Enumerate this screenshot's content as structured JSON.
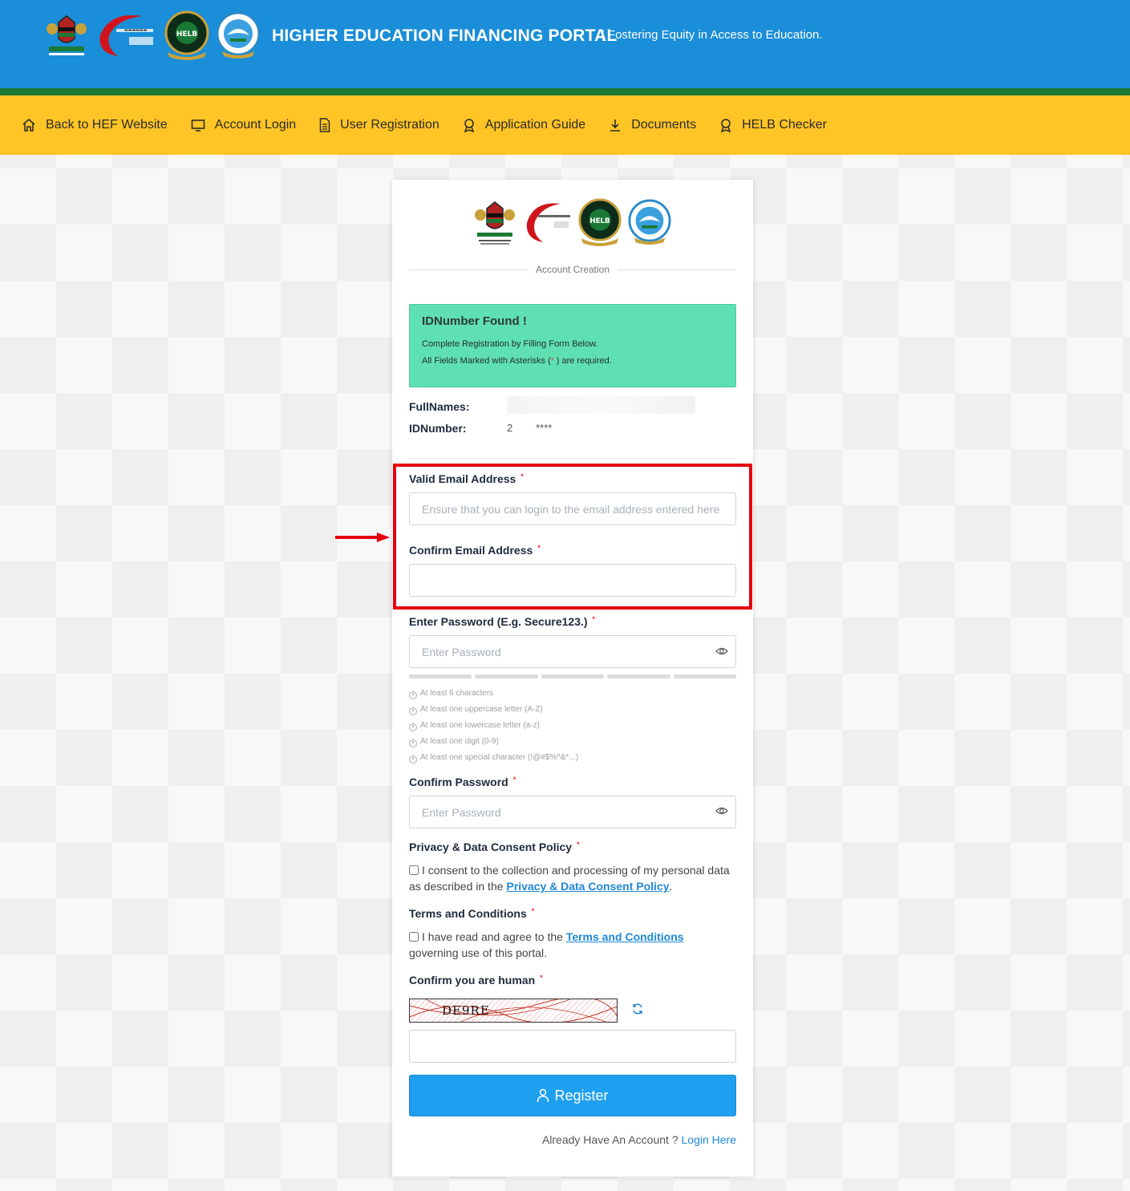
{
  "header": {
    "title": "HIGHER EDUCATION FINANCING PORTAL",
    "tagline": "Fostering Equity in Access to Education."
  },
  "nav": [
    {
      "label": "Back to HEF Website",
      "icon": "home-icon"
    },
    {
      "label": "Account Login",
      "icon": "monitor-icon"
    },
    {
      "label": "User Registration",
      "icon": "document-icon"
    },
    {
      "label": "Application Guide",
      "icon": "award-icon"
    },
    {
      "label": "Documents",
      "icon": "download-icon"
    },
    {
      "label": "HELB Checker",
      "icon": "award-icon"
    }
  ],
  "card": {
    "section_title": "Account Creation",
    "alert": {
      "title": "IDNumber Found !",
      "line1": "Complete Registration by Filling Form Below.",
      "line2_pre": "All Fields Marked with Asterisks (",
      "line2_ast": "*",
      "line2_post": ") are required."
    },
    "fullnames_label": "FullNames:",
    "fullnames_value": "",
    "idnumber_label": "IDNumber:",
    "idnumber_value": "2        ****",
    "email": {
      "label": "Valid Email Address",
      "placeholder": "Ensure that you can login to the email address entered here",
      "value": ""
    },
    "confirm_email": {
      "label": "Confirm Email Address",
      "placeholder": "",
      "value": ""
    },
    "password": {
      "label": "Enter Password (E.g. Secure123.)",
      "placeholder": "Enter Password"
    },
    "password_rules": [
      "At least 6 characters",
      "At least one uppercase letter (A-Z)",
      "At least one lowercase letter (a-z)",
      "At least one digit (0-9)",
      "At least one special character (!@#$%^&*...)"
    ],
    "confirm_password": {
      "label": "Confirm Password",
      "placeholder": "Enter Password"
    },
    "privacy": {
      "label": "Privacy & Data Consent Policy",
      "text_pre": "I consent to the collection and processing of my personal data as described in the ",
      "link": "Privacy & Data Consent Policy",
      "text_post": "."
    },
    "terms": {
      "label": "Terms and Conditions",
      "text_pre": "I have read and agree to the ",
      "link": "Terms and Conditions",
      "text_post": "governing use of this portal."
    },
    "captcha": {
      "label": "Confirm you are human",
      "code": "DE9RE",
      "input_value": ""
    },
    "register_label": "Register",
    "already_text": "Already Have An Account ?",
    "login_link": "Login Here"
  },
  "colors": {
    "header_blue": "#1a8ed8",
    "nav_yellow": "#ffc425",
    "green_stripe": "#1a7a35",
    "alert_green": "#5fe0b3",
    "button_blue": "#1e9ff0",
    "highlight_red": "#e5000f"
  }
}
